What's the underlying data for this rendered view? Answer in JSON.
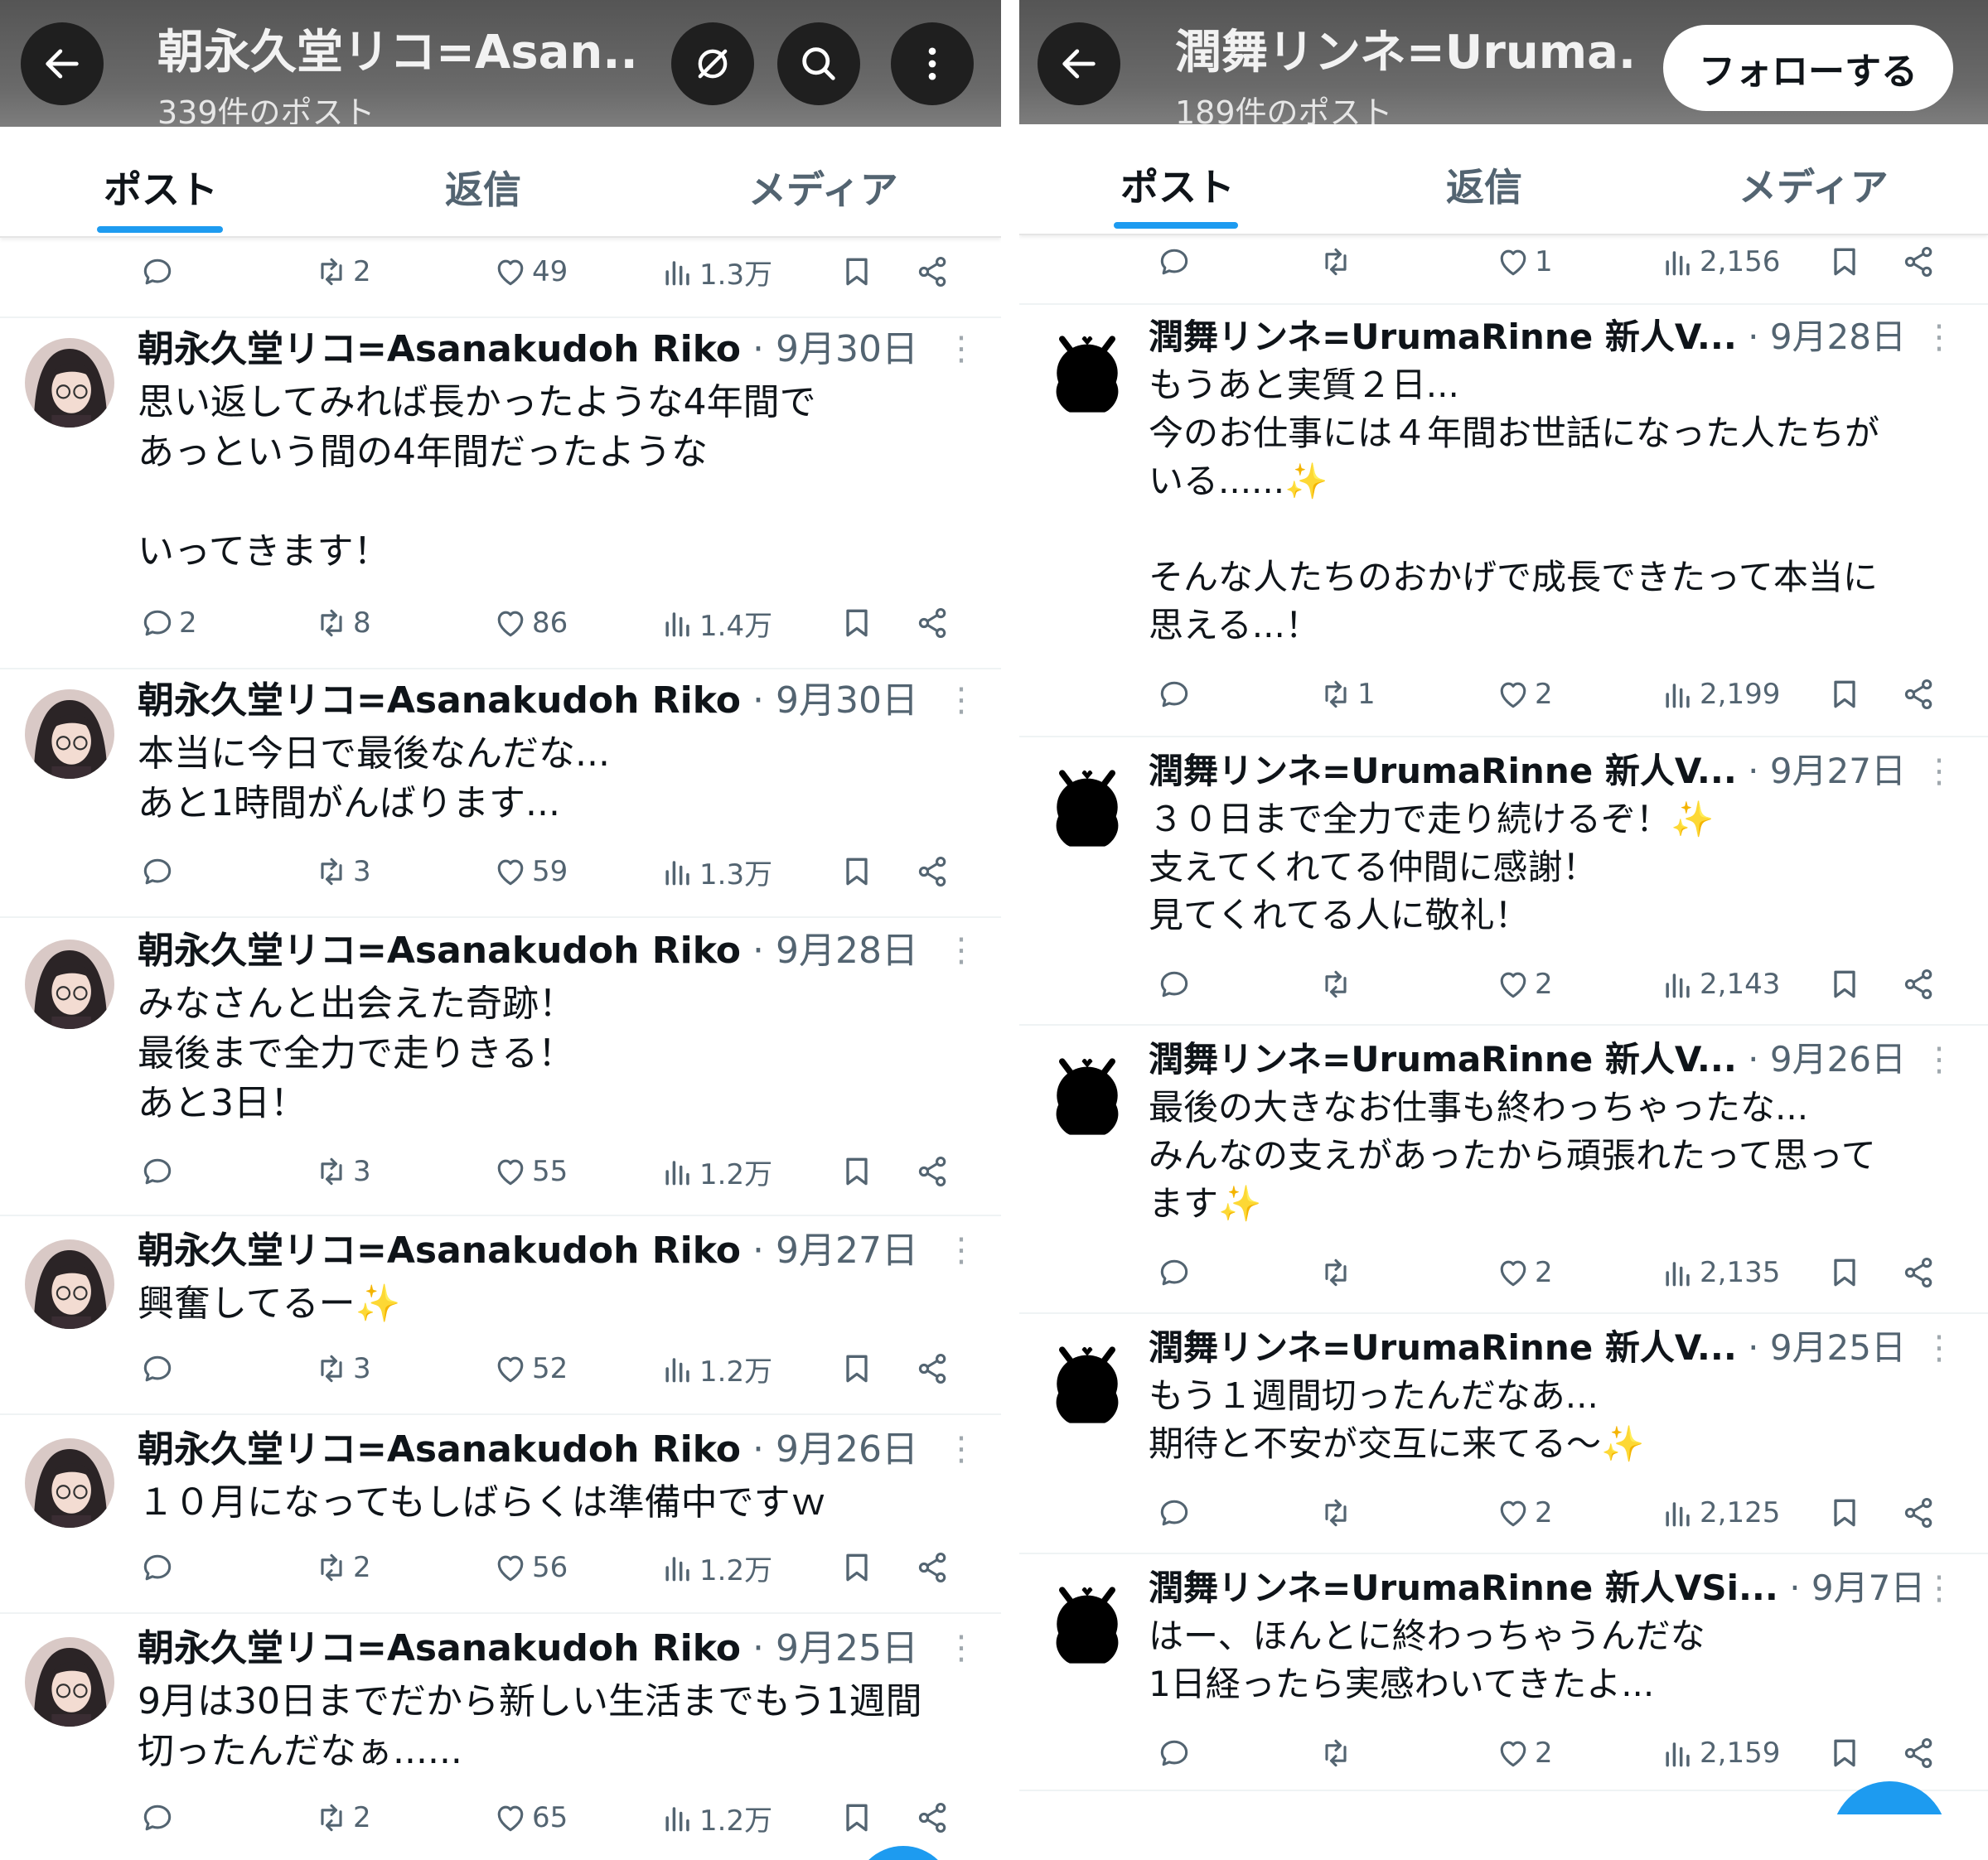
{
  "left": {
    "header": {
      "title": "朝永久堂リコ=Asan...",
      "subtitle": "339件のポスト"
    },
    "tabs": [
      "ポスト",
      "返信",
      "メディア"
    ],
    "top_actions": {
      "reply": "",
      "repost": "2",
      "like": "49",
      "views": "1.3万"
    },
    "tweets": [
      {
        "name": "朝永久堂リコ=Asanakudoh Riko",
        "meta": " · 9月30日",
        "text": "思い返してみれば長かったような4年間で\nあっという間の4年間だったような\n\nいってきます！",
        "reply": "2",
        "repost": "8",
        "like": "86",
        "views": "1.4万"
      },
      {
        "name": "朝永久堂リコ=Asanakudoh Riko",
        "meta": " · 9月30日",
        "text": "本当に今日で最後なんだな...\nあと1時間がんばります...",
        "reply": "",
        "repost": "3",
        "like": "59",
        "views": "1.3万"
      },
      {
        "name": "朝永久堂リコ=Asanakudoh Riko",
        "meta": " · 9月28日",
        "text": "みなさんと出会えた奇跡！\n最後まで全力で走りきる！\nあと3日！",
        "reply": "",
        "repost": "3",
        "like": "55",
        "views": "1.2万"
      },
      {
        "name": "朝永久堂リコ=Asanakudoh Riko",
        "meta": " · 9月27日",
        "text": "興奮してるー✨",
        "reply": "",
        "repost": "3",
        "like": "52",
        "views": "1.2万"
      },
      {
        "name": "朝永久堂リコ=Asanakudoh Riko",
        "meta": " · 9月26日",
        "text": "１０月になってもしばらくは準備中ですｗ",
        "reply": "",
        "repost": "2",
        "like": "56",
        "views": "1.2万"
      },
      {
        "name": "朝永久堂リコ=Asanakudoh Riko",
        "meta": " · 9月25日",
        "text": "9月は30日までだから新しい生活までもう1週間\n切ったんだなぁ......",
        "reply": "",
        "repost": "2",
        "like": "65",
        "views": "1.2万"
      }
    ]
  },
  "right": {
    "header": {
      "title": "潤舞リンネ=Uruma...",
      "subtitle": "189件のポスト",
      "follow_label": "フォローする"
    },
    "tabs": [
      "ポスト",
      "返信",
      "メディア"
    ],
    "top_actions": {
      "reply": "",
      "repost": "",
      "like": "1",
      "views": "2,156"
    },
    "tweets": [
      {
        "name": "潤舞リンネ=UrumaRinne 新人V...",
        "meta": " · 9月28日",
        "text": "もうあと実質２日...\n今のお仕事には４年間お世話になった人たちが\nいる......✨\n\nそんな人たちのおかげで成長できたって本当に\n思える...！",
        "reply": "",
        "repost": "1",
        "like": "2",
        "views": "2,199"
      },
      {
        "name": "潤舞リンネ=UrumaRinne 新人V...",
        "meta": " · 9月27日",
        "text": "３０日まで全力で走り続けるぞ！✨\n支えてくれてる仲間に感謝！\n見てくれてる人に敬礼！",
        "reply": "",
        "repost": "",
        "like": "2",
        "views": "2,143"
      },
      {
        "name": "潤舞リンネ=UrumaRinne 新人V...",
        "meta": " · 9月26日",
        "text": "最後の大きなお仕事も終わっちゃったな...\nみんなの支えがあったから頑張れたって思って\nます✨",
        "reply": "",
        "repost": "",
        "like": "2",
        "views": "2,135"
      },
      {
        "name": "潤舞リンネ=UrumaRinne 新人V...",
        "meta": " · 9月25日",
        "text": "もう１週間切ったんだなあ...\n期待と不安が交互に来てる〜✨",
        "reply": "",
        "repost": "",
        "like": "2",
        "views": "2,125"
      },
      {
        "name": "潤舞リンネ=UrumaRinne 新人VSi...",
        "meta": " · 9月7日",
        "text": "はー、ほんとに終わっちゃうんだな\n1日経ったら実感わいてきたよ...",
        "reply": "",
        "repost": "",
        "like": "2",
        "views": "2,159"
      }
    ]
  }
}
